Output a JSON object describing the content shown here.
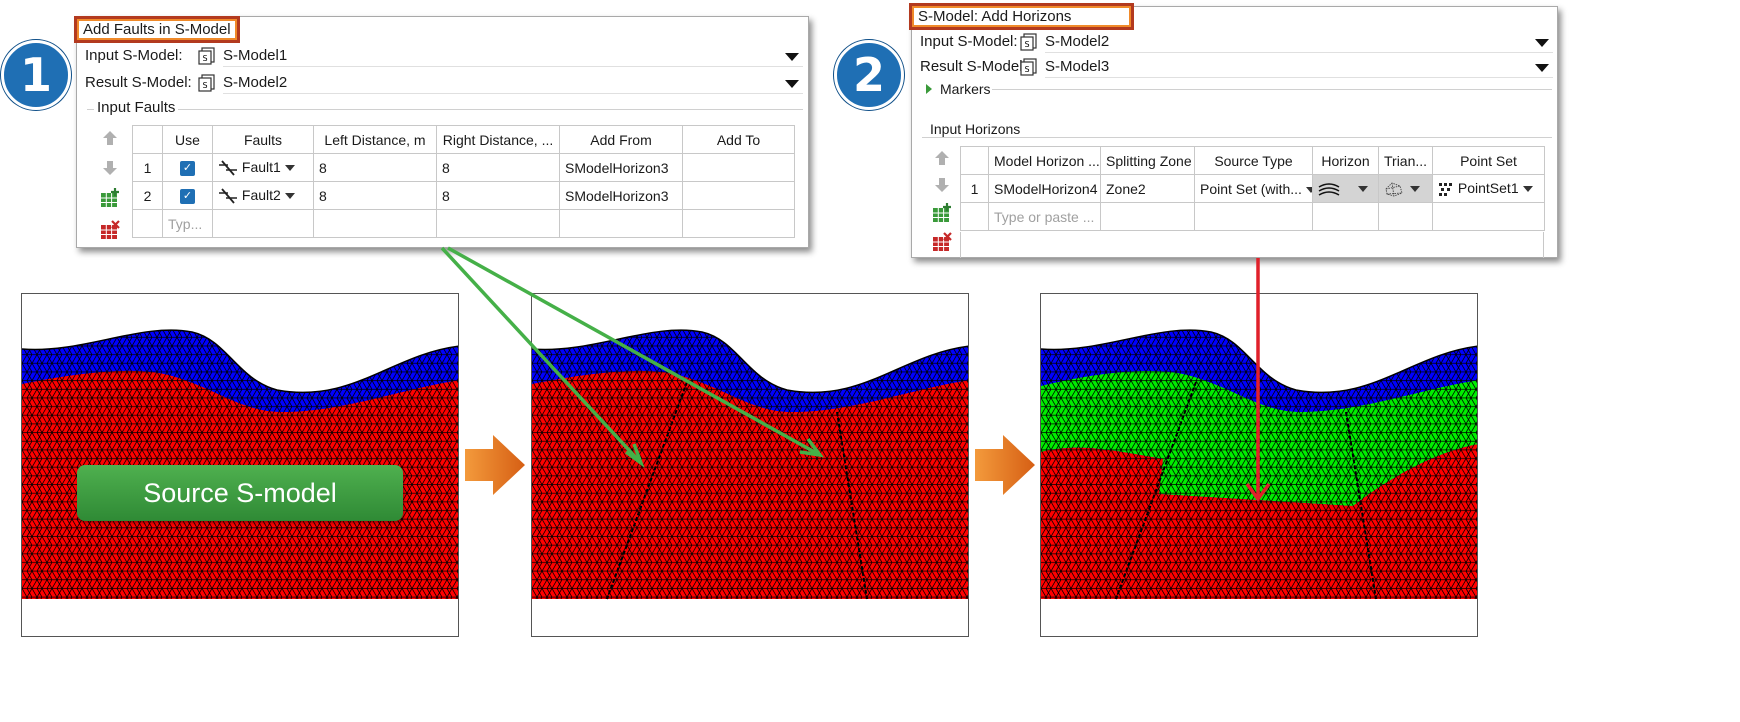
{
  "step1": {
    "number": "1",
    "window": {
      "title": "Add Faults in S-Model",
      "input_label": "Input S-Model:",
      "input_value": "S-Model1",
      "result_label": "Result S-Model:",
      "result_value": "S-Model2",
      "group_label": "Input Faults",
      "columns": [
        "Use",
        "Faults",
        "Left Distance, m",
        "Right Distance, ...",
        "Add From",
        "Add To"
      ],
      "rows": [
        {
          "num": "1",
          "fault": "Fault1",
          "left": "8",
          "right": "8",
          "add_from": "SModelHorizon3",
          "add_to": ""
        },
        {
          "num": "2",
          "fault": "Fault2",
          "left": "8",
          "right": "8",
          "add_from": "SModelHorizon3",
          "add_to": ""
        }
      ],
      "placeholder": "Typ..."
    }
  },
  "step2": {
    "number": "2",
    "window": {
      "title": "S-Model: Add Horizons",
      "input_label": "Input S-Model:",
      "input_value": "S-Model2",
      "result_label": "Result S-Model:",
      "result_value": "S-Model3",
      "markers_label": "Markers",
      "group_label": "Input Horizons",
      "columns": [
        "Model Horizon ...",
        "Splitting Zone",
        "Source Type",
        "Horizon",
        "Trian...",
        "Point Set"
      ],
      "rows": [
        {
          "num": "1",
          "model_horizon": "SModelHorizon4",
          "zone": "Zone2",
          "source_type": "Point Set (with...",
          "point_set": "PointSet1"
        }
      ],
      "placeholder": "Type or paste ..."
    }
  },
  "badge": "Source S-model",
  "colors": {
    "step_circle": "#1f6fb4",
    "title_border": "#b33a1f",
    "layer_blue": "#0000ff",
    "layer_red": "#ff0000",
    "layer_green": "#00ee00",
    "arrow_green": "#45b048",
    "arrow_red": "#e0202a",
    "arrow_orange": "#e8731f"
  }
}
